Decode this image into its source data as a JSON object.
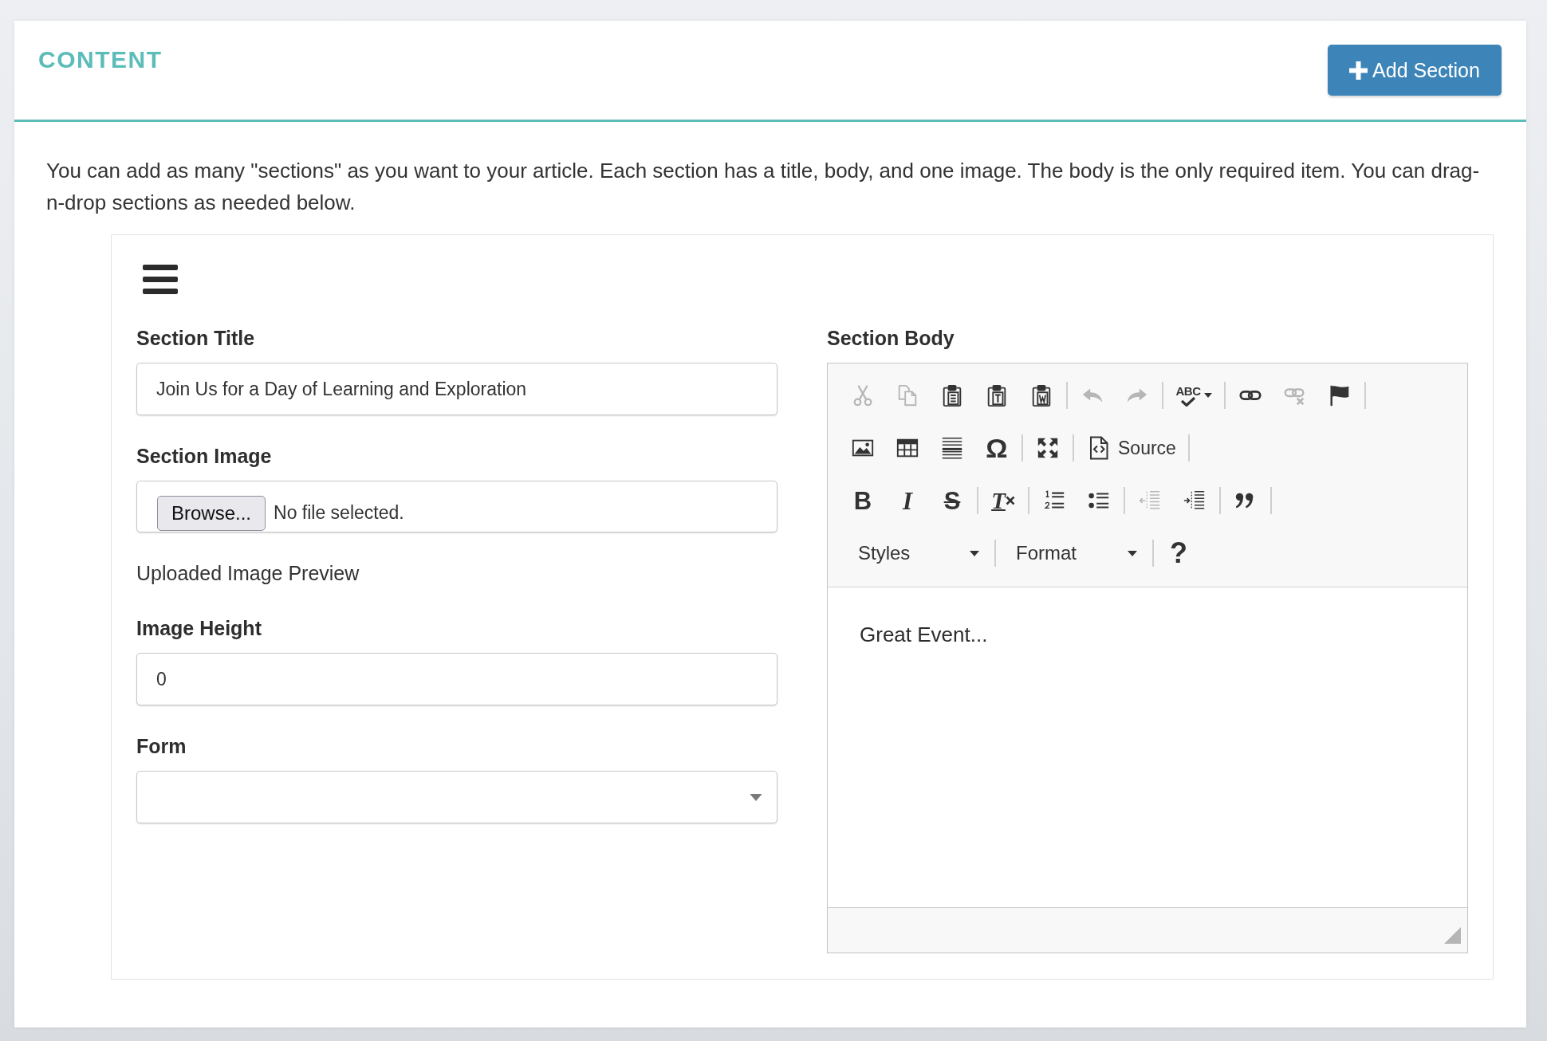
{
  "header": {
    "title": "CONTENT",
    "action": "Add Section"
  },
  "intro": "You can add as many \"sections\" as you want to your article. Each section has a title, body, and one image. The body is the only required item. You can drag-n-drop sections as needed below.",
  "section": {
    "fields": [
      {
        "kind": "text",
        "label": "Section Title",
        "value": "Join Us for a Day of Learning and Exploration"
      },
      {
        "kind": "file",
        "label": "Section Image",
        "button": "Browse...",
        "status": "No file selected."
      },
      {
        "kind": "preview",
        "text": "Uploaded Image Preview"
      },
      {
        "kind": "text",
        "label": "Image Height",
        "value": "0"
      },
      {
        "kind": "select",
        "label": "Form"
      }
    ],
    "body": {
      "label": "Section Body",
      "toolbar": {
        "rows": [
          {
            "items": [
              {
                "kind": "cut",
                "disabled": true
              },
              {
                "kind": "copy",
                "disabled": true
              },
              {
                "kind": "paste",
                "disabled": false
              },
              {
                "kind": "paste_text",
                "disabled": false
              },
              {
                "kind": "paste_word",
                "disabled": false
              },
              {
                "kind": "separator"
              },
              {
                "kind": "undo",
                "disabled": true
              },
              {
                "kind": "redo",
                "disabled": true
              },
              {
                "kind": "separator"
              },
              {
                "kind": "spellcheck",
                "label": "ABC",
                "disabled": false
              },
              {
                "kind": "separator"
              },
              {
                "kind": "link",
                "disabled": false
              },
              {
                "kind": "unlink",
                "disabled": true
              },
              {
                "kind": "anchor",
                "disabled": false
              },
              {
                "kind": "separator"
              }
            ]
          },
          {
            "items": [
              {
                "kind": "image",
                "disabled": false
              },
              {
                "kind": "table",
                "disabled": false
              },
              {
                "kind": "horizontal_rule",
                "disabled": false
              },
              {
                "kind": "special_char",
                "label": "Ω",
                "disabled": false
              },
              {
                "kind": "separator"
              },
              {
                "kind": "maximize",
                "disabled": false
              },
              {
                "kind": "separator"
              },
              {
                "kind": "source",
                "label": "Source",
                "disabled": false
              },
              {
                "kind": "separator"
              }
            ]
          },
          {
            "items": [
              {
                "kind": "bold",
                "label": "B",
                "disabled": false
              },
              {
                "kind": "italic",
                "label": "I",
                "disabled": false
              },
              {
                "kind": "strike",
                "label": "S",
                "disabled": false
              },
              {
                "kind": "separator"
              },
              {
                "kind": "remove_format",
                "label": "T",
                "disabled": false
              },
              {
                "kind": "separator"
              },
              {
                "kind": "numbered_list",
                "disabled": false
              },
              {
                "kind": "bulleted_list",
                "disabled": false
              },
              {
                "kind": "separator"
              },
              {
                "kind": "outdent",
                "disabled": true
              },
              {
                "kind": "indent",
                "disabled": false
              },
              {
                "kind": "separator"
              },
              {
                "kind": "blockquote",
                "disabled": false
              },
              {
                "kind": "separator"
              }
            ]
          },
          {
            "items": [
              {
                "kind": "combo",
                "label": "Styles",
                "disabled": false
              },
              {
                "kind": "separator"
              },
              {
                "kind": "combo",
                "label": "Format",
                "disabled": false
              },
              {
                "kind": "separator"
              },
              {
                "kind": "help",
                "label": "?",
                "disabled": false
              }
            ]
          }
        ]
      },
      "content": "Great Event..."
    }
  }
}
